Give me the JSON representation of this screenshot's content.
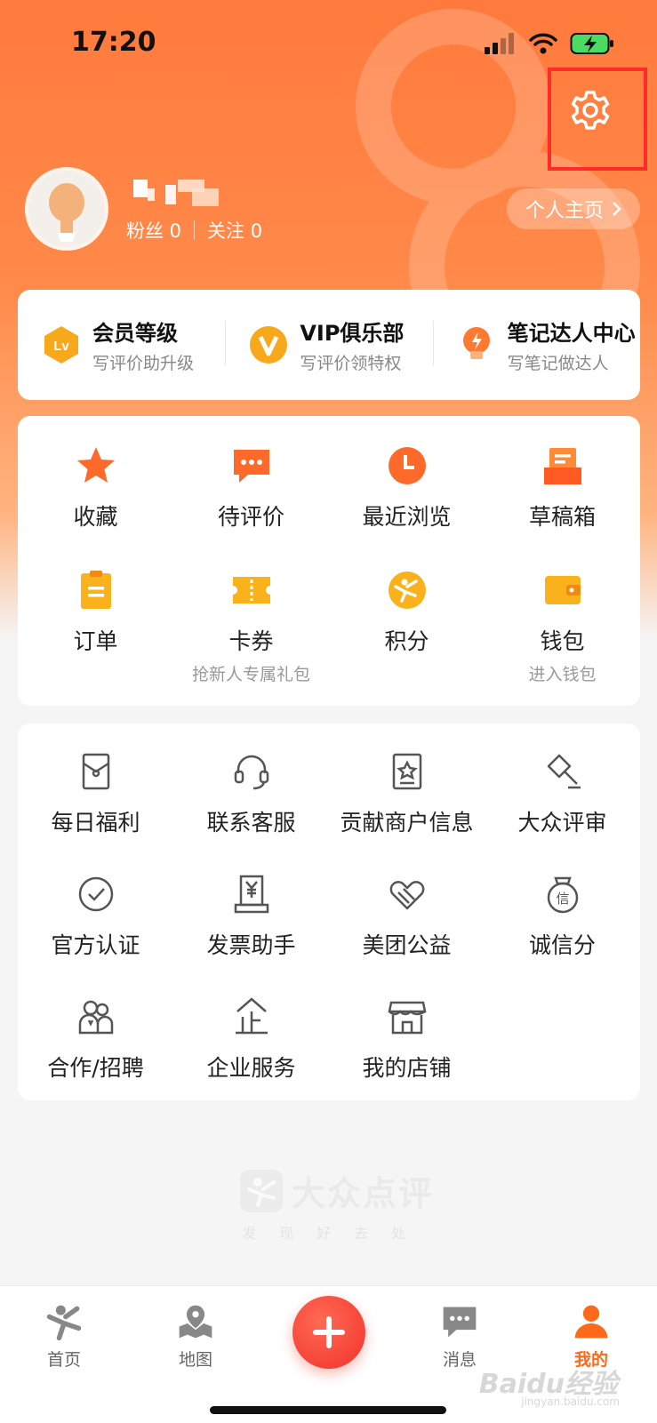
{
  "status_bar": {
    "time": "17:20"
  },
  "colors": {
    "accent": "#ff6a1a",
    "hero_top": "#ff7a3c",
    "highlight": "#ff2a2a",
    "fab": "#f2322a"
  },
  "profile": {
    "fans_label": "粉丝 0",
    "follow_label": "关注 0",
    "homepage_label": "个人主页"
  },
  "member": [
    {
      "icon": "lv-badge-icon",
      "title": "会员等级",
      "sub": "写评价助升级"
    },
    {
      "icon": "vip-badge-icon",
      "title": "VIP俱乐部",
      "sub": "写评价领特权"
    },
    {
      "icon": "lightbulb-icon",
      "title": "笔记达人中心",
      "sub": "写笔记做达人"
    }
  ],
  "main_grid": [
    {
      "icon": "star-icon",
      "label": "收藏",
      "sub": ""
    },
    {
      "icon": "comment-icon",
      "label": "待评价",
      "sub": ""
    },
    {
      "icon": "clock-icon",
      "label": "最近浏览",
      "sub": ""
    },
    {
      "icon": "draft-box-icon",
      "label": "草稿箱",
      "sub": ""
    },
    {
      "icon": "order-icon",
      "label": "订单",
      "sub": ""
    },
    {
      "icon": "coupon-icon",
      "label": "卡券",
      "sub": "抢新人专属礼包"
    },
    {
      "icon": "points-icon",
      "label": "积分",
      "sub": ""
    },
    {
      "icon": "wallet-icon",
      "label": "钱包",
      "sub": "进入钱包"
    }
  ],
  "service_grid": [
    {
      "icon": "red-packet-icon",
      "label": "每日福利"
    },
    {
      "icon": "headset-icon",
      "label": "联系客服"
    },
    {
      "icon": "merchant-info-icon",
      "label": "贡献商户信息"
    },
    {
      "icon": "gavel-icon",
      "label": "大众评审"
    },
    {
      "icon": "check-circle-icon",
      "label": "官方认证"
    },
    {
      "icon": "invoice-icon",
      "label": "发票助手"
    },
    {
      "icon": "charity-heart-icon",
      "label": "美团公益"
    },
    {
      "icon": "credit-badge-icon",
      "label": "诚信分"
    },
    {
      "icon": "partners-icon",
      "label": "合作/招聘"
    },
    {
      "icon": "enterprise-icon",
      "label": "企业服务"
    },
    {
      "icon": "store-icon",
      "label": "我的店铺"
    }
  ],
  "brand": {
    "name": "大众点评",
    "slogan": "发现好去处"
  },
  "tabbar": [
    {
      "icon": "home-tab-icon",
      "label": "首页",
      "active": false
    },
    {
      "icon": "map-tab-icon",
      "label": "地图",
      "active": false
    },
    {
      "icon": "message-tab-icon",
      "label": "消息",
      "active": false
    },
    {
      "icon": "profile-tab-icon",
      "label": "我的",
      "active": true
    }
  ],
  "watermark": {
    "text": "Baidu经验",
    "sub": "jingyan.baidu.com"
  }
}
